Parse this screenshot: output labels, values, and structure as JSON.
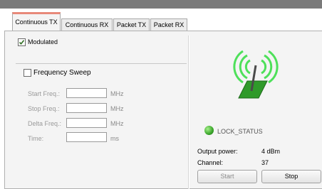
{
  "tabs": [
    {
      "label": "Continuous TX",
      "active": true
    },
    {
      "label": "Continuous RX",
      "active": false
    },
    {
      "label": "Packet TX",
      "active": false
    },
    {
      "label": "Packet RX",
      "active": false
    }
  ],
  "modulated": {
    "label": "Modulated",
    "checked": true
  },
  "frequency_sweep": {
    "label": "Frequency Sweep",
    "checked": false
  },
  "sweep_fields": [
    {
      "label": "Start Freq.:",
      "value": "",
      "unit": "MHz"
    },
    {
      "label": "Stop Freq.:",
      "value": "",
      "unit": "MHz"
    },
    {
      "label": "Delta Freq.:",
      "value": "",
      "unit": "MHz"
    },
    {
      "label": "Time:",
      "value": "",
      "unit": "ms"
    }
  ],
  "status": {
    "lock_label": "LOCK_STATUS",
    "lock_color": "#3aa52a",
    "output_power_label": "Output power:",
    "output_power_value": "4 dBm",
    "channel_label": "Channel:",
    "channel_value": "37"
  },
  "buttons": {
    "start": "Start",
    "stop": "Stop"
  },
  "colors": {
    "active_tab_accent": "#e8897a",
    "antenna_waves": "#4ee05a",
    "antenna_base": "#2f9a2a"
  }
}
